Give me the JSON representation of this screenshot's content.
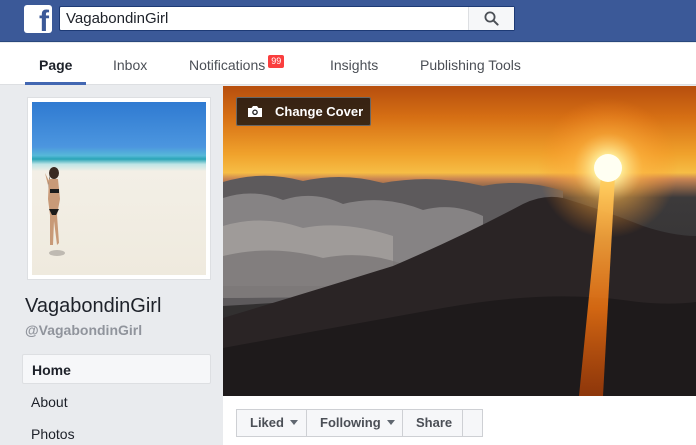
{
  "topbar": {
    "logo": "f",
    "search_value": "VagabondinGirl",
    "search_icon": "search-icon"
  },
  "tabs": [
    {
      "label": "Page",
      "active": true
    },
    {
      "label": "Inbox",
      "active": false
    },
    {
      "label": "Notifications",
      "active": false,
      "badge": "99"
    },
    {
      "label": "Insights",
      "active": false
    },
    {
      "label": "Publishing Tools",
      "active": false
    }
  ],
  "profile": {
    "name": "VagabondinGirl",
    "handle": "@VagabondinGirl"
  },
  "sidebar": {
    "items": [
      {
        "label": "Home",
        "active": true
      },
      {
        "label": "About",
        "active": false
      },
      {
        "label": "Photos",
        "active": false
      }
    ]
  },
  "cover": {
    "change_cover_label": "Change Cover",
    "camera_icon": "camera-icon"
  },
  "actions": {
    "liked_label": "Liked",
    "following_label": "Following",
    "share_label": "Share"
  },
  "colors": {
    "brand": "#3b5998",
    "badge": "#fa3e3e",
    "tab_underline": "#4267b2"
  }
}
